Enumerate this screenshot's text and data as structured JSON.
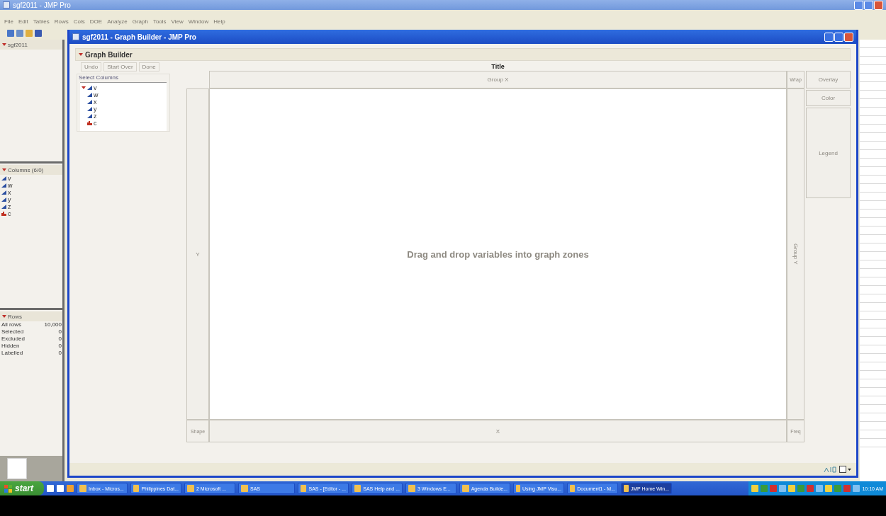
{
  "main_window": {
    "title": "sgf2011 - JMP Pro"
  },
  "menu": [
    "File",
    "Edit",
    "Tables",
    "Rows",
    "Cols",
    "DOE",
    "Analyze",
    "Graph",
    "Tools",
    "View",
    "Window",
    "Help"
  ],
  "left_panel": {
    "table_header": "sgf2011",
    "columns_header": "Columns (6/0)",
    "columns": [
      {
        "name": "v",
        "kind": "continuous"
      },
      {
        "name": "w",
        "kind": "continuous"
      },
      {
        "name": "x",
        "kind": "continuous"
      },
      {
        "name": "y",
        "kind": "continuous"
      },
      {
        "name": "z",
        "kind": "continuous"
      },
      {
        "name": "c",
        "kind": "nominal"
      }
    ],
    "rows_header": "Rows",
    "rows": [
      {
        "label": "All rows",
        "value": "10,000"
      },
      {
        "label": "Selected",
        "value": "0"
      },
      {
        "label": "Excluded",
        "value": "0"
      },
      {
        "label": "Hidden",
        "value": "0"
      },
      {
        "label": "Labelled",
        "value": "0"
      }
    ]
  },
  "graph_window": {
    "title": "sgf2011 - Graph Builder - JMP Pro",
    "report_title": "Graph Builder",
    "buttons": [
      "Undo",
      "Start Over",
      "Done"
    ],
    "select_columns": {
      "label": "Select Columns",
      "columns": [
        {
          "name": "v",
          "kind": "continuous"
        },
        {
          "name": "w",
          "kind": "continuous"
        },
        {
          "name": "x",
          "kind": "continuous"
        },
        {
          "name": "y",
          "kind": "continuous"
        },
        {
          "name": "z",
          "kind": "continuous"
        },
        {
          "name": "c",
          "kind": "nominal"
        }
      ]
    },
    "zones": {
      "title": "Title",
      "group_x": "Group X",
      "wrap": "Wrap",
      "overlay": "Overlay",
      "color_zone": "Color",
      "legend": "Legend",
      "y": "Y",
      "group_y": "Group Y",
      "map_shape": "Shape",
      "x": "X",
      "freq": "Freq",
      "hint": "Drag and drop variables into graph zones"
    }
  },
  "taskbar": {
    "start": "start",
    "items": [
      {
        "label": "Inbox - Micros...",
        "selected": false
      },
      {
        "label": "Philippines Dat...",
        "selected": false
      },
      {
        "label": "2 Microsoft ...",
        "selected": false
      },
      {
        "label": "SAS",
        "selected": false
      },
      {
        "label": "SAS - [Editor - ...",
        "selected": false
      },
      {
        "label": "SAS Help and ...",
        "selected": false
      },
      {
        "label": "3 Windows E...",
        "selected": false
      },
      {
        "label": "Agenda Builde...",
        "selected": false
      },
      {
        "label": "Using JMP Visu...",
        "selected": false
      },
      {
        "label": "Document1 - M...",
        "selected": false
      },
      {
        "label": "JMP Home Win...",
        "selected": true
      }
    ],
    "clock": "10:10 AM"
  }
}
